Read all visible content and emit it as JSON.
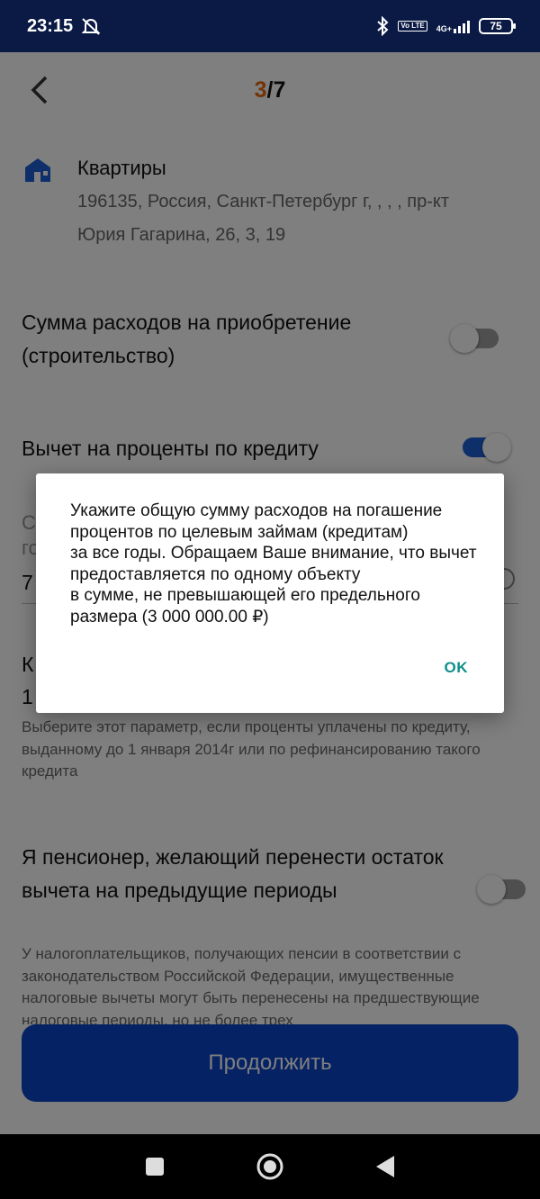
{
  "status_bar": {
    "time": "23:15",
    "network": "4G+",
    "volte": "Vo LTE",
    "battery": "75"
  },
  "header": {
    "step_current": "3",
    "step_total": "/7"
  },
  "property": {
    "title": "Квартиры",
    "address": "196135, Россия, Санкт-Петербург г, , , , пр-кт Юрия Гагарина, 26, 3, 19"
  },
  "options": {
    "purchase": {
      "label": "Сумма расходов на приобретение (строительство)",
      "enabled": false
    },
    "interest": {
      "label": "Вычет на проценты по кредиту",
      "enabled": true
    },
    "partial_label_1": "С",
    "partial_label_2": "го",
    "partial_value": "7",
    "partial_title_1": "К",
    "partial_title_2": "1",
    "refinance_desc": "Выберите этот параметр, если проценты уплачены по кредиту, выданному до 1 января 2014г или по рефинансированию такого кредита",
    "pensioner": {
      "label": "Я пенсионер, желающий перенести остаток вычета на предыдущие периоды",
      "enabled": false
    },
    "pensioner_desc": "У налогоплательщиков, получающих пенсии в соответствии с законодательством Российской Федерации, имущественные налоговые вычеты могут быть перенесены на предшествующие налоговые периоды, но не более трех"
  },
  "continue_label": "Продолжить",
  "dialog": {
    "message": "Укажите общую сумму расходов на погашение процентов по целевым займам (кредитам)\nза все годы. Обращаем Ваше внимание, что вычет предоставляется по одному объекту\nв сумме, не превышающей его предельного размера (3 000 000.00 ₽)",
    "ok_label": "OK"
  },
  "colors": {
    "accent": "#0a44c9",
    "step_highlight": "#e8670c",
    "dialog_button": "#0f8f8a",
    "status_bar": "#0a1a45"
  }
}
